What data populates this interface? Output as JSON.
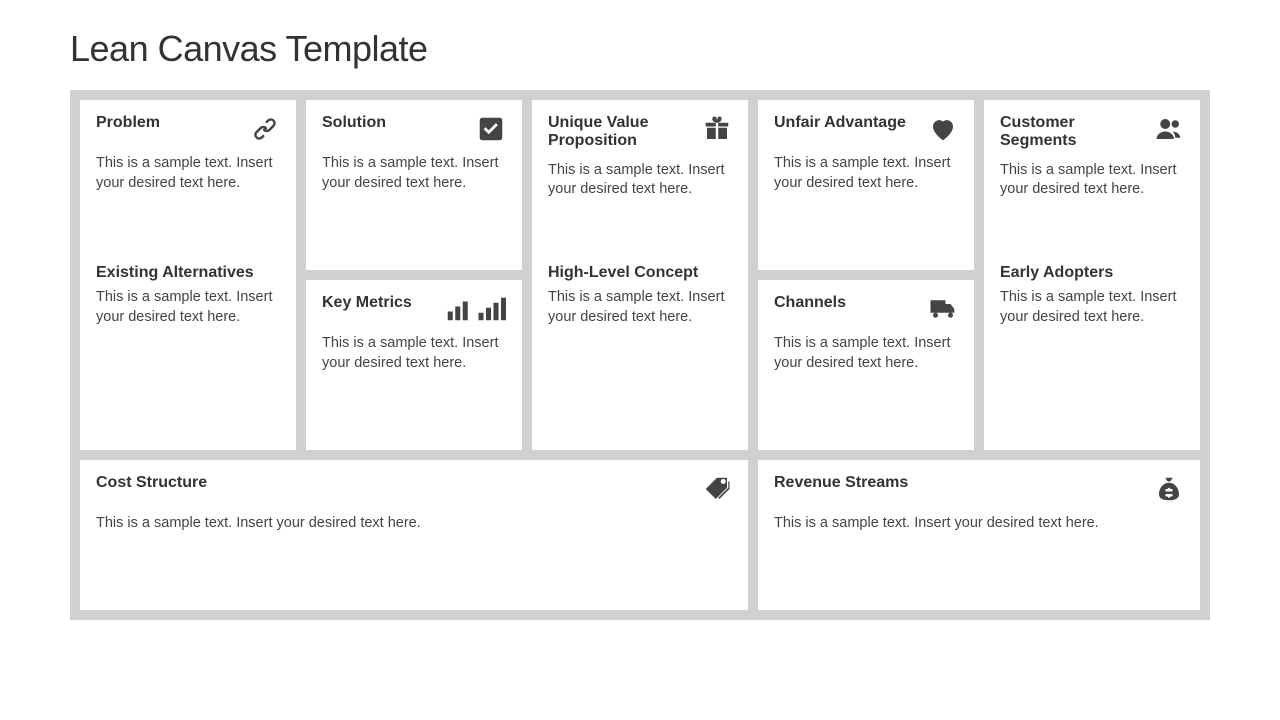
{
  "title": "Lean Canvas Template",
  "cells": {
    "problem": {
      "title": "Problem",
      "body": "This is a sample text. Insert your desired text here.",
      "sub_title": "Existing Alternatives",
      "sub_body": "This is a sample text. Insert your desired text here."
    },
    "solution": {
      "title": "Solution",
      "body": "This is a sample text. Insert your desired text here."
    },
    "metrics": {
      "title": "Key Metrics",
      "body": "This is a sample text. Insert your desired text here."
    },
    "uvp": {
      "title": "Unique Value Proposition",
      "body": "This is a sample text. Insert your desired text here.",
      "sub_title": "High-Level Concept",
      "sub_body": "This is a sample text. Insert your desired text here."
    },
    "unfair": {
      "title": "Unfair Advantage",
      "body": "This is a sample text. Insert your desired text here."
    },
    "channels": {
      "title": "Channels",
      "body": "This is a sample text. Insert your desired text here."
    },
    "customers": {
      "title": "Customer Segments",
      "body": "This is a sample text. Insert your desired text here.",
      "sub_title": "Early Adopters",
      "sub_body": "This is a sample text. Insert your desired text here."
    },
    "cost": {
      "title": "Cost Structure",
      "body": "This is a sample text. Insert your desired text here."
    },
    "revenue": {
      "title": "Revenue Streams",
      "body": "This is a sample text. Insert your desired text here."
    }
  }
}
